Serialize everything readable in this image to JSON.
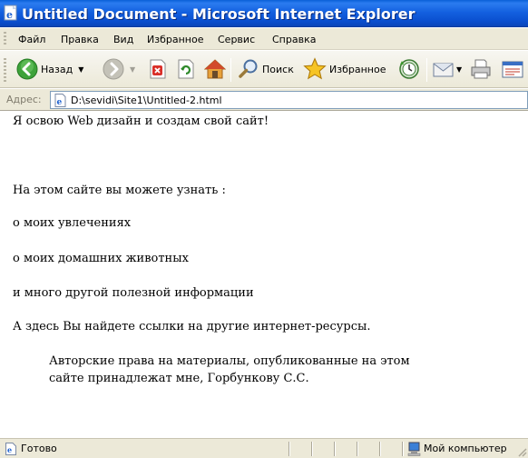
{
  "window": {
    "title": "Untitled Document - Microsoft Internet Explorer",
    "title_bar_color": "#0a5fd8"
  },
  "menu": {
    "items": [
      "Файл",
      "Правка",
      "Вид",
      "Избранное",
      "Сервис",
      "Справка"
    ]
  },
  "toolbar": {
    "back_label": "Назад",
    "search_label": "Поиск",
    "favorites_label": "Избранное",
    "icons": [
      "back-arrow-icon",
      "forward-arrow-icon",
      "stop-icon",
      "refresh-icon",
      "home-icon",
      "search-icon",
      "favorites-star-icon",
      "history-icon",
      "mail-icon",
      "print-icon",
      "edit-icon"
    ]
  },
  "address": {
    "label": "Адрес:",
    "value": "D:\\sevidi\\Site1\\Untitled-2.html"
  },
  "page": {
    "lines": [
      "Я освою Web дизайн и создам свой сайт!",
      "На этом сайте вы можете узнать :",
      "о моих увлечениях",
      "о моих домашних животных",
      "и много другой полезной информации",
      "А здесь Вы найдете ссылки на другие интернет-ресурсы."
    ],
    "copyright": [
      "Авторские права на материалы, опубликованные на этом",
      "сайте принадлежат мне, Горбункову С.С."
    ]
  },
  "status": {
    "text": "Готово",
    "zone": "Мой компьютер"
  }
}
